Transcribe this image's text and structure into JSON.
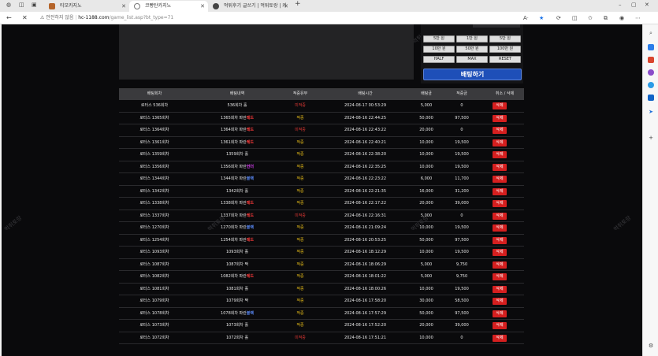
{
  "browser": {
    "tabs": [
      {
        "title": "티모카지노"
      },
      {
        "title": "코빵탄카지노"
      },
      {
        "title": "먹튀후기 글쓰기 | 먹튀토랑 | 커"
      }
    ],
    "url_warning": "안전하지 않음",
    "url_host": "hc-1188.com",
    "url_path": "/game_list.asp?bt_type=71"
  },
  "watermark": "먹튀토랑",
  "bet_panel": {
    "amount_buttons": [
      "5만 원",
      "1만 원",
      "5만 원",
      "10만 원",
      "50만 원",
      "100만 원"
    ],
    "option_buttons": [
      "HALF",
      "MAX",
      "RESET"
    ],
    "bet_label": "배팅하기"
  },
  "table": {
    "headers": [
      "배팅회차",
      "배팅내역",
      "적중유무",
      "배팅시간",
      "배팅금",
      "적중금",
      "취소 / 삭제"
    ],
    "delete_label": "삭제",
    "rows": [
      {
        "round": "로터스 536회차",
        "detail": "536회차 홀",
        "mark": "",
        "mark_color": "",
        "status": "미적중",
        "time": "2024-08-17 00:53:29",
        "amount": "5,000",
        "win": "0"
      },
      {
        "round": "로터스 1365회차",
        "detail": "1365회차 파란",
        "mark": "레드",
        "mark_color": "#ff3b3b",
        "status": "적중",
        "time": "2024-08-16 22:44:25",
        "amount": "50,000",
        "win": "97,500"
      },
      {
        "round": "로터스 1364회차",
        "detail": "1364회차 파란",
        "mark": "레드",
        "mark_color": "#ff3b3b",
        "status": "미적중",
        "time": "2024-08-16 22:43:22",
        "amount": "20,000",
        "win": "0"
      },
      {
        "round": "로터스 1361회차",
        "detail": "1361회차 파란",
        "mark": "레드",
        "mark_color": "#ff3b3b",
        "status": "적중",
        "time": "2024-08-16 22:40:21",
        "amount": "10,000",
        "win": "19,500"
      },
      {
        "round": "로터스 1359회차",
        "detail": "1359회차 홀",
        "mark": "",
        "mark_color": "",
        "status": "적중",
        "time": "2024-08-16 22:38:20",
        "amount": "10,000",
        "win": "19,500"
      },
      {
        "round": "로터스 1356회차",
        "detail": "1356회차 파란",
        "mark": "언더",
        "mark_color": "#e040fb",
        "status": "적중",
        "time": "2024-08-16 22:35:25",
        "amount": "10,000",
        "win": "19,500"
      },
      {
        "round": "로터스 1344회차",
        "detail": "1344회차 파란",
        "mark": "블랙",
        "mark_color": "#5c8dff",
        "status": "적중",
        "time": "2024-08-16 22:23:22",
        "amount": "6,000",
        "win": "11,700"
      },
      {
        "round": "로터스 1342회차",
        "detail": "1342회차 홀",
        "mark": "",
        "mark_color": "",
        "status": "적중",
        "time": "2024-08-16 22:21:35",
        "amount": "16,000",
        "win": "31,200"
      },
      {
        "round": "로터스 1338회차",
        "detail": "1338회차 파란",
        "mark": "레드",
        "mark_color": "#ff3b3b",
        "status": "적중",
        "time": "2024-08-16 22:17:22",
        "amount": "20,000",
        "win": "39,000"
      },
      {
        "round": "로터스 1337회차",
        "detail": "1337회차 파란",
        "mark": "레드",
        "mark_color": "#ff3b3b",
        "status": "미적중",
        "time": "2024-08-16 22:16:31",
        "amount": "5,000",
        "win": "0"
      },
      {
        "round": "로터스 1270회차",
        "detail": "1270회차 파란",
        "mark": "블랙",
        "mark_color": "#5c8dff",
        "status": "적중",
        "time": "2024-08-16 21:09:24",
        "amount": "10,000",
        "win": "19,500"
      },
      {
        "round": "로터스 1254회차",
        "detail": "1254회차 파란",
        "mark": "레드",
        "mark_color": "#ff3b3b",
        "status": "적중",
        "time": "2024-08-16 20:53:25",
        "amount": "50,000",
        "win": "97,500"
      },
      {
        "round": "로터스 1093회차",
        "detail": "1093회차 홀",
        "mark": "",
        "mark_color": "",
        "status": "적중",
        "time": "2024-08-16 18:12:29",
        "amount": "10,000",
        "win": "19,500"
      },
      {
        "round": "로터스 1087회차",
        "detail": "1087회차 짝",
        "mark": "",
        "mark_color": "",
        "status": "적중",
        "time": "2024-08-16 18:06:29",
        "amount": "5,000",
        "win": "9,750"
      },
      {
        "round": "로터스 1082회차",
        "detail": "1082회차 파란",
        "mark": "레드",
        "mark_color": "#ff3b3b",
        "status": "적중",
        "time": "2024-08-16 18:01:22",
        "amount": "5,000",
        "win": "9,750"
      },
      {
        "round": "로터스 1081회차",
        "detail": "1081회차 홀",
        "mark": "",
        "mark_color": "",
        "status": "적중",
        "time": "2024-08-16 18:00:26",
        "amount": "10,000",
        "win": "19,500"
      },
      {
        "round": "로터스 1079회차",
        "detail": "1079회차 짝",
        "mark": "",
        "mark_color": "",
        "status": "적중",
        "time": "2024-08-16 17:58:20",
        "amount": "30,000",
        "win": "58,500"
      },
      {
        "round": "로터스 1078회차",
        "detail": "1078회차 파란",
        "mark": "블랙",
        "mark_color": "#5c8dff",
        "status": "적중",
        "time": "2024-08-16 17:57:29",
        "amount": "50,000",
        "win": "97,500"
      },
      {
        "round": "로터스 1073회차",
        "detail": "1073회차 홀",
        "mark": "",
        "mark_color": "",
        "status": "적중",
        "time": "2024-08-16 17:52:20",
        "amount": "20,000",
        "win": "39,000"
      },
      {
        "round": "로터스 1072회차",
        "detail": "1072회차 홀",
        "mark": "",
        "mark_color": "",
        "status": "미적중",
        "time": "2024-08-16 17:51:21",
        "amount": "10,000",
        "win": "0"
      }
    ]
  }
}
